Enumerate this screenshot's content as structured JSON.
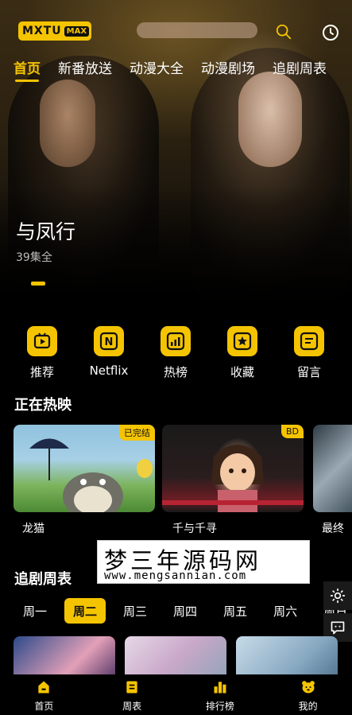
{
  "app": {
    "logo_main": "MXTU",
    "logo_sub": "MAX"
  },
  "top_tabs": [
    {
      "label": "首页",
      "active": true
    },
    {
      "label": "新番放送",
      "active": false
    },
    {
      "label": "动漫大全",
      "active": false
    },
    {
      "label": "动漫剧场",
      "active": false
    },
    {
      "label": "追剧周表",
      "active": false
    }
  ],
  "hero": {
    "title": "与凤行",
    "subtitle": "39集全"
  },
  "quick_actions": [
    {
      "label": "推荐",
      "icon": "recommend-icon"
    },
    {
      "label": "Netflix",
      "icon": "netflix-icon"
    },
    {
      "label": "热榜",
      "icon": "hot-chart-icon"
    },
    {
      "label": "收藏",
      "icon": "favorite-star-icon"
    },
    {
      "label": "留言",
      "icon": "message-icon"
    }
  ],
  "now_showing": {
    "title": "正在热映",
    "items": [
      {
        "label": "龙猫",
        "badge": "已完结"
      },
      {
        "label": "千与千寻",
        "badge": "BD"
      },
      {
        "label": "最终"
      }
    ]
  },
  "watermark": {
    "title": "梦三年源码网",
    "url": "www.mengsannian.com"
  },
  "schedule": {
    "title": "追剧周表",
    "days": [
      {
        "label": "周一",
        "active": false
      },
      {
        "label": "周二",
        "active": true
      },
      {
        "label": "周三",
        "active": false
      },
      {
        "label": "周四",
        "active": false
      },
      {
        "label": "周五",
        "active": false
      },
      {
        "label": "周六",
        "active": false
      },
      {
        "label": "周日",
        "active": false
      }
    ]
  },
  "bottom_nav": [
    {
      "label": "首页",
      "icon": "home-icon"
    },
    {
      "label": "周表",
      "icon": "schedule-icon"
    },
    {
      "label": "排行榜",
      "icon": "ranking-icon"
    },
    {
      "label": "我的",
      "icon": "profile-bear-icon"
    }
  ],
  "colors": {
    "accent": "#f5c400",
    "background": "#000000",
    "text": "#ffffff"
  }
}
